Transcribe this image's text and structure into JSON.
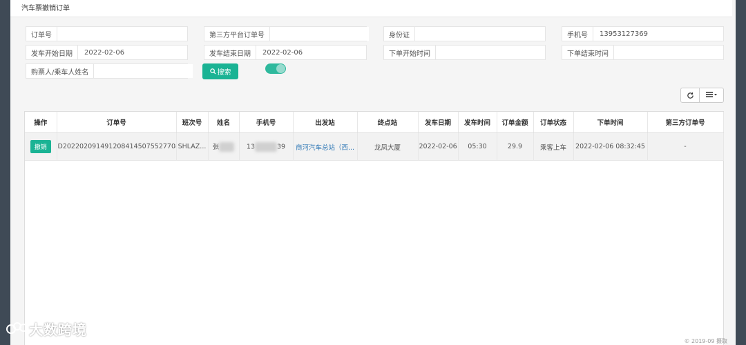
{
  "page_title": "汽车票撤销订单",
  "form": {
    "order_no": {
      "label": "订单号",
      "value": ""
    },
    "third_order_no": {
      "label": "第三方平台订单号",
      "value": ""
    },
    "id_card": {
      "label": "身份证",
      "value": ""
    },
    "phone": {
      "label": "手机号",
      "value": "13953127369"
    },
    "depart_start": {
      "label": "发车开始日期",
      "value": "2022-02-06"
    },
    "depart_end": {
      "label": "发车结束日期",
      "value": "2022-02-06"
    },
    "order_start": {
      "label": "下单开始时间",
      "value": ""
    },
    "order_end": {
      "label": "下单结束时间",
      "value": ""
    },
    "buyer_name": {
      "label": "购票人/乘车人姓名",
      "value": ""
    },
    "search_label": "搜索",
    "toggle_on": true
  },
  "table": {
    "headers": [
      "操作",
      "订单号",
      "班次号",
      "姓名",
      "手机号",
      "出发站",
      "终点站",
      "发车日期",
      "发车时间",
      "订单金额",
      "订单状态",
      "下单时间",
      "第三方订单号"
    ],
    "rows": [
      {
        "action": "撤销",
        "order_no": "D2022020914912084145075527708",
        "trip_no": "SHLAZ...",
        "name": "张",
        "phone_prefix": "13",
        "phone_suffix": "39",
        "depart_station": "商河汽车总站（西...",
        "end_station": "龙凤大厦",
        "depart_date": "2022-02-06",
        "depart_time": "05:30",
        "amount": "29.9",
        "status": "乘客上车",
        "order_time": "2022-02-06 08:32:45",
        "third_order_no": "-"
      }
    ]
  },
  "watermark": "大数跨境",
  "footer": "© 2019-09 摄取",
  "icons": {
    "search": "search-icon",
    "refresh": "refresh-icon",
    "columns": "list-icon"
  }
}
